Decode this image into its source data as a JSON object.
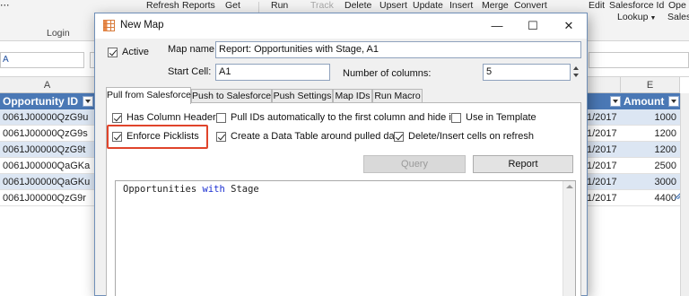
{
  "ribbon": {
    "items": [
      "Refresh",
      "Reports",
      "Get",
      "Run",
      "Track",
      "Delete",
      "Upsert",
      "Update",
      "Insert",
      "Merge",
      "Convert",
      "Edit",
      "Salesforce Id",
      "Ope"
    ],
    "second_row": [
      "Lookup",
      "Sales"
    ],
    "group_name": "Login"
  },
  "name_box": {
    "value": "A"
  },
  "columns": {
    "a": "A",
    "e": "E"
  },
  "sheet": {
    "headers": {
      "opportunity_id": "Opportunity ID",
      "amount": "Amount"
    },
    "rows": [
      {
        "id": "0061J00000QzG9u",
        "date": "1/2017",
        "amount": "1000"
      },
      {
        "id": "0061J00000QzG9s",
        "date": "1/2017",
        "amount": "1200"
      },
      {
        "id": "0061J00000QzG9t",
        "date": "1/2017",
        "amount": "1200"
      },
      {
        "id": "0061J00000QaGKa",
        "date": "1/2017",
        "amount": "2500"
      },
      {
        "id": "0061J00000QaGKu",
        "date": "1/2017",
        "amount": "3000"
      },
      {
        "id": "0061J00000QzG9r",
        "date": "1/2017",
        "amount": "4400"
      }
    ]
  },
  "dialog": {
    "title": "New Map",
    "window_buttons": {
      "minimize": "—",
      "maximize": "☐",
      "close": "✕"
    },
    "active_label": "Active",
    "map_name_label": "Map name:",
    "map_name_value": "Report: Opportunities with Stage, A1",
    "start_cell_label": "Start Cell:",
    "start_cell_value": "A1",
    "num_columns_label": "Number of columns:",
    "num_columns_value": "5",
    "tabs": [
      "Pull from Salesforce",
      "Push to Salesforce",
      "Push Settings",
      "Map IDs",
      "Run Macro"
    ],
    "options": {
      "has_column_headers": "Has Column Headers",
      "pull_ids": "Pull IDs automatically to the first column and hide it",
      "use_in_template": "Use in Template",
      "enforce_picklists": "Enforce Picklists",
      "create_data_table": "Create a Data Table around pulled data",
      "delete_insert_cells": "Delete/Insert cells on refresh"
    },
    "query_button": "Query",
    "report_button": "Report",
    "editor": {
      "word1": "Opportunities",
      "keyword": "with",
      "word2": "Stage"
    }
  },
  "colors": {
    "header_blue": "#4a78b5",
    "band_blue": "#dce6f3",
    "highlight_red": "#e0442b",
    "keyword_blue": "#1a2ed1"
  },
  "icons": [
    "table-icon",
    "checkbox-icon",
    "filter-dropdown-icon",
    "spin-arrows-icon"
  ]
}
